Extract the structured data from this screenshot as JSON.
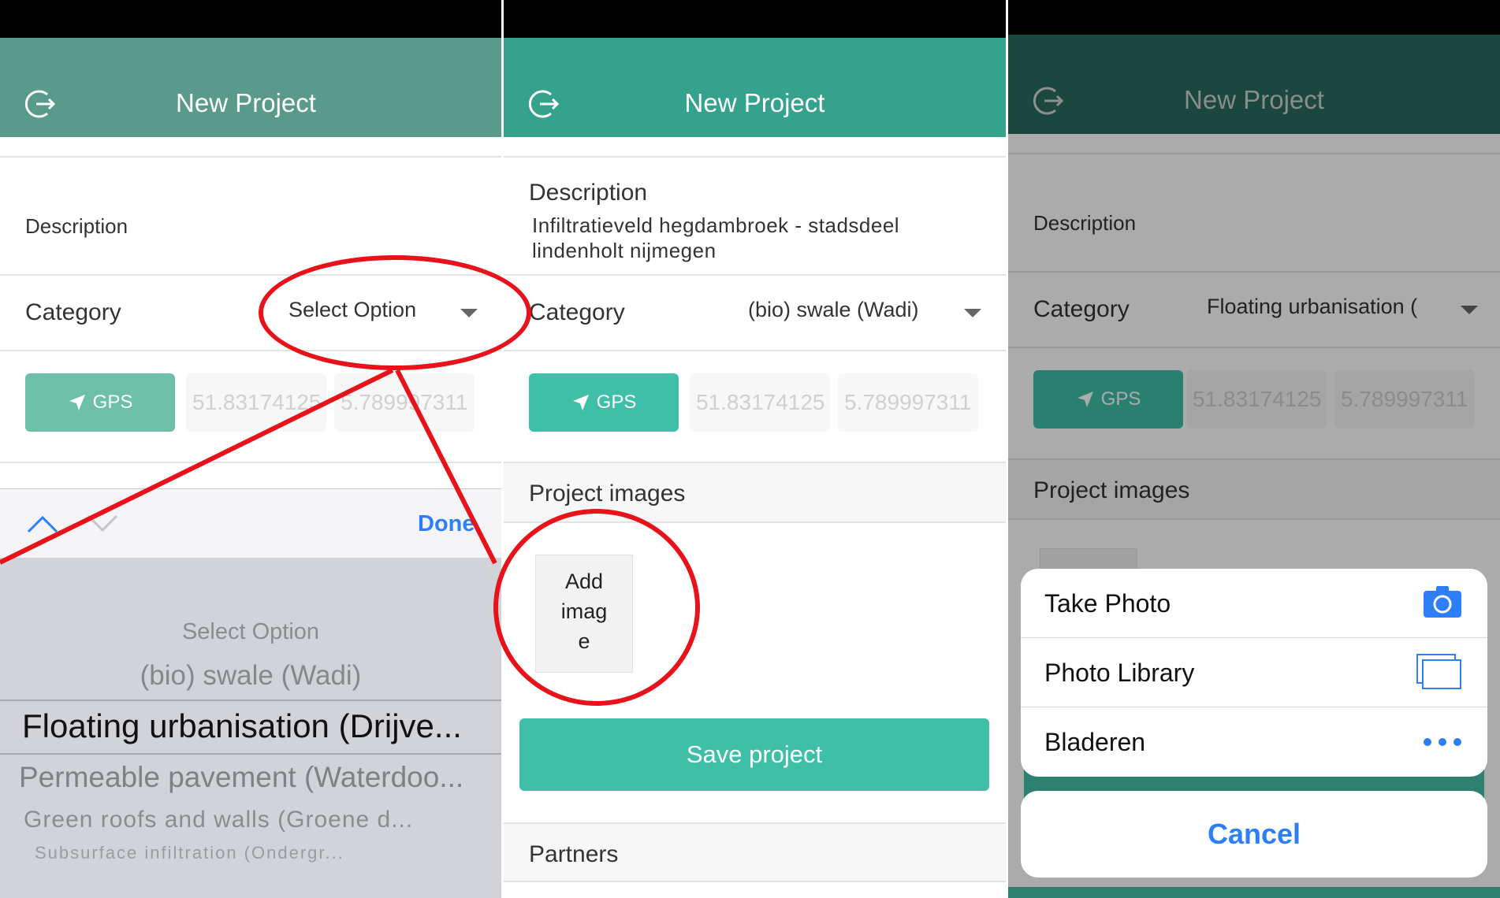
{
  "colors": {
    "appbar_p1": "#5a9a8a",
    "appbar_p2": "#35a28e",
    "appbar_p3": "#2a6a5e",
    "gps_p1": "#6dbfa7",
    "gps_p2": "#3fbfa7",
    "gps_p3": "#2e7a6a",
    "save_button": "#40bfa8",
    "ios_blue": "#2d7ff9",
    "annotation_red": "#e8131a"
  },
  "panel1": {
    "header": {
      "title": "New Project",
      "logout_icon": "logout-icon"
    },
    "description_placeholder": "Description",
    "category": {
      "label": "Category",
      "value": "Select Option"
    },
    "gps": {
      "label": "GPS",
      "lat": "51.83174125",
      "lon": "5.789997311"
    },
    "picker": {
      "done_label": "Done",
      "options": [
        "Select Option",
        "(bio) swale (Wadi)",
        "Floating urbanisation (Drijve...",
        "Permeable pavement (Waterdoo...",
        "Green roofs and walls (Groene d...",
        "Subsurface infiltration (Ondergr..."
      ]
    }
  },
  "panel2": {
    "header": {
      "title": "New Project",
      "logout_icon": "logout-icon"
    },
    "description": {
      "label": "Description",
      "value": "Infiltratieveld hegdambroek - stadsdeel lindenholt nijmegen"
    },
    "category": {
      "label": "Category",
      "value": "(bio) swale (Wadi)"
    },
    "gps": {
      "label": "GPS",
      "lat": "51.83174125",
      "lon": "5.789997311"
    },
    "images_header": "Project images",
    "add_image": [
      "Add",
      "imag",
      "e"
    ],
    "save_label": "Save project",
    "partners_header": "Partners"
  },
  "panel3": {
    "header": {
      "title": "New Project",
      "logout_icon": "logout-icon"
    },
    "description_placeholder": "Description",
    "category": {
      "label": "Category",
      "value": "Floating urbanisation ("
    },
    "gps": {
      "label": "GPS",
      "lat": "51.83174125",
      "lon": "5.789997311"
    },
    "images_header": "Project images",
    "sheet": {
      "items": [
        {
          "label": "Take Photo",
          "icon": "camera-icon"
        },
        {
          "label": "Photo Library",
          "icon": "photo-library-icon"
        },
        {
          "label": "Bladeren",
          "icon": "more-dots-icon"
        }
      ],
      "cancel_label": "Cancel"
    }
  }
}
